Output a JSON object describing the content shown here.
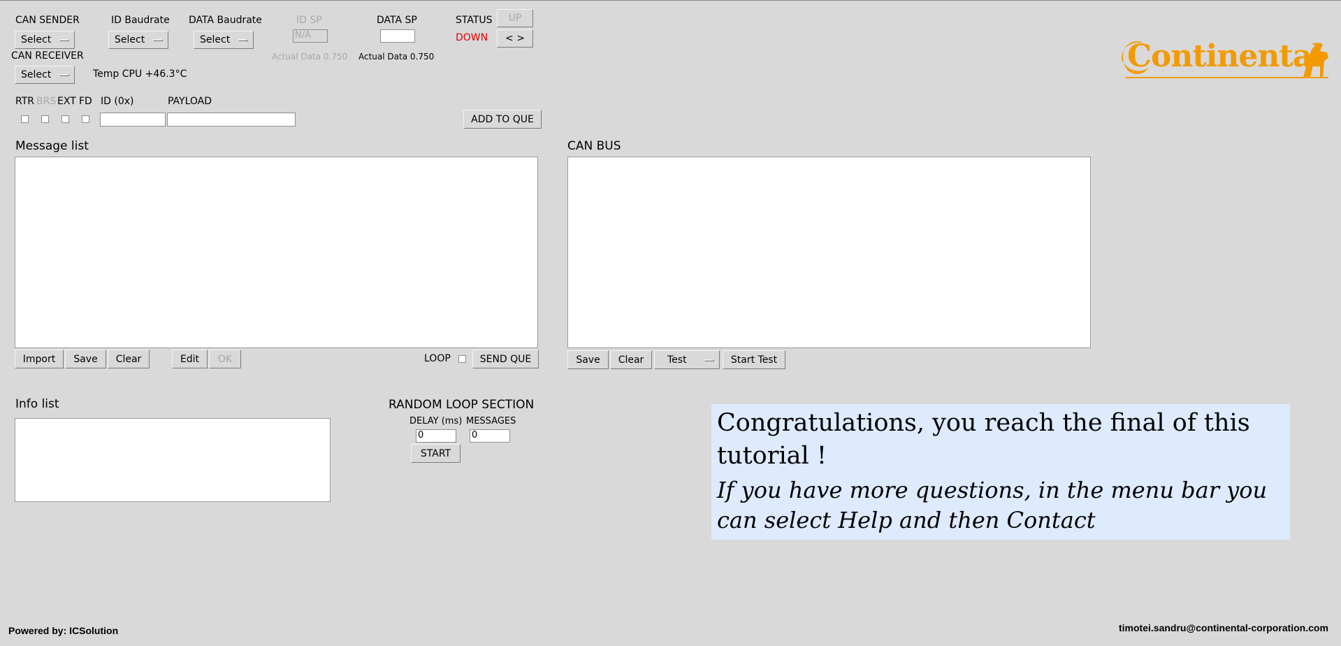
{
  "top": {
    "can_sender": {
      "label": "CAN SENDER",
      "value": "Select"
    },
    "id_baudrate": {
      "label": "ID Baudrate",
      "value": "Select"
    },
    "data_baudrate": {
      "label": "DATA Baudrate",
      "value": "Select"
    },
    "id_sp": {
      "label": "ID SP",
      "value": "N/A",
      "actual": "Actual Data 0.750"
    },
    "data_sp": {
      "label": "DATA SP",
      "value": "",
      "actual": "Actual Data 0.750"
    },
    "status": {
      "label": "STATUS",
      "value": "DOWN",
      "value_color": "#e00000"
    },
    "up_button": "UP",
    "nav_button": "< >",
    "can_receiver": {
      "label": "CAN RECEIVER",
      "value": "Select"
    },
    "temp_cpu": "Temp CPU +46.3°C",
    "logo_text": "Continental",
    "logo_color": "#f29a00"
  },
  "frame": {
    "rtr": "RTR",
    "brs": "BRS",
    "ext": "EXT",
    "fd": "FD",
    "id_label": "ID (0x)",
    "id_value": "",
    "payload_label": "PAYLOAD",
    "payload_value": "",
    "add_button": "ADD TO QUE"
  },
  "message_list": {
    "title": "Message list",
    "import": "Import",
    "save": "Save",
    "clear": "Clear",
    "edit": "Edit",
    "ok": "OK",
    "loop": "LOOP",
    "send": "SEND QUE"
  },
  "can_bus": {
    "title": "CAN BUS",
    "save": "Save",
    "clear": "Clear",
    "test_option": "Test",
    "start_test": "Start Test"
  },
  "info_list": {
    "title": "Info list"
  },
  "random_loop": {
    "title": "RANDOM LOOP SECTION",
    "delay_label": "DELAY (ms)",
    "messages_label": "MESSAGES",
    "delay_value": "0",
    "messages_value": "0",
    "start": "START"
  },
  "note": {
    "line1": "Congratulations, you reach the final of this tutorial !",
    "line2": "If you have more questions, in the menu bar you can select Help and then Contact",
    "background": "#deeafd"
  },
  "footer": {
    "powered": "Powered by: ICSolution",
    "email": "timotei.sandru@continental-corporation.com"
  }
}
